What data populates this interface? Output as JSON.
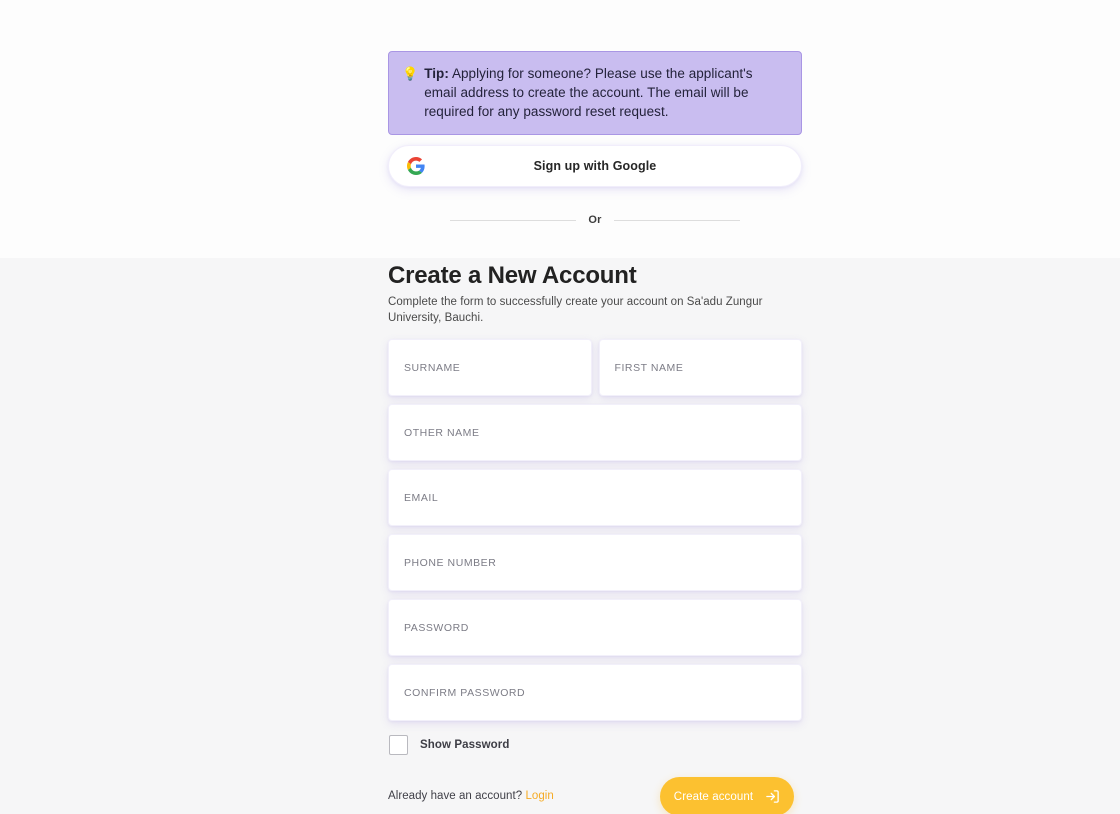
{
  "theme": {
    "accent": "#fcc130",
    "link": "#f5ab25",
    "tip_bg": "#c9bdf0",
    "tip_border": "#a996e4",
    "page_bg": "#f6f6f7",
    "card_bg": "#ffffff"
  },
  "tip": {
    "icon": "light-bulb-icon",
    "label": "Tip:",
    "text": " Applying for someone? Please use the applicant's email address to create the account. The email will be required for any password reset request."
  },
  "google_button": {
    "icon": "google-logo-icon",
    "label": "Sign up with Google"
  },
  "divider": {
    "label": "Or"
  },
  "header": {
    "title": "Create a New Account",
    "subtitle": "Complete the form to successfully create your account on Sa'adu Zungur University, Bauchi."
  },
  "form": {
    "rows": [
      {
        "fields": [
          {
            "name": "surname-input",
            "label": "SURNAME",
            "value": ""
          },
          {
            "name": "first-name-input",
            "label": "FIRST NAME",
            "value": ""
          }
        ]
      },
      {
        "fields": [
          {
            "name": "other-name-input",
            "label": "OTHER NAME",
            "value": ""
          }
        ]
      },
      {
        "fields": [
          {
            "name": "email-input",
            "label": "EMAIL",
            "value": ""
          }
        ]
      },
      {
        "fields": [
          {
            "name": "phone-number-input",
            "label": "PHONE NUMBER",
            "value": ""
          }
        ]
      },
      {
        "fields": [
          {
            "name": "password-input",
            "label": "PASSWORD",
            "value": ""
          }
        ]
      },
      {
        "fields": [
          {
            "name": "confirm-password-input",
            "label": "CONFIRM PASSWORD",
            "value": ""
          }
        ]
      }
    ],
    "show_password": {
      "label": "Show Password",
      "checked": false
    }
  },
  "footer": {
    "note": "Already have an account?",
    "login_label": "Login",
    "submit_label": "Create account",
    "submit_icon": "login-arrow-icon"
  }
}
